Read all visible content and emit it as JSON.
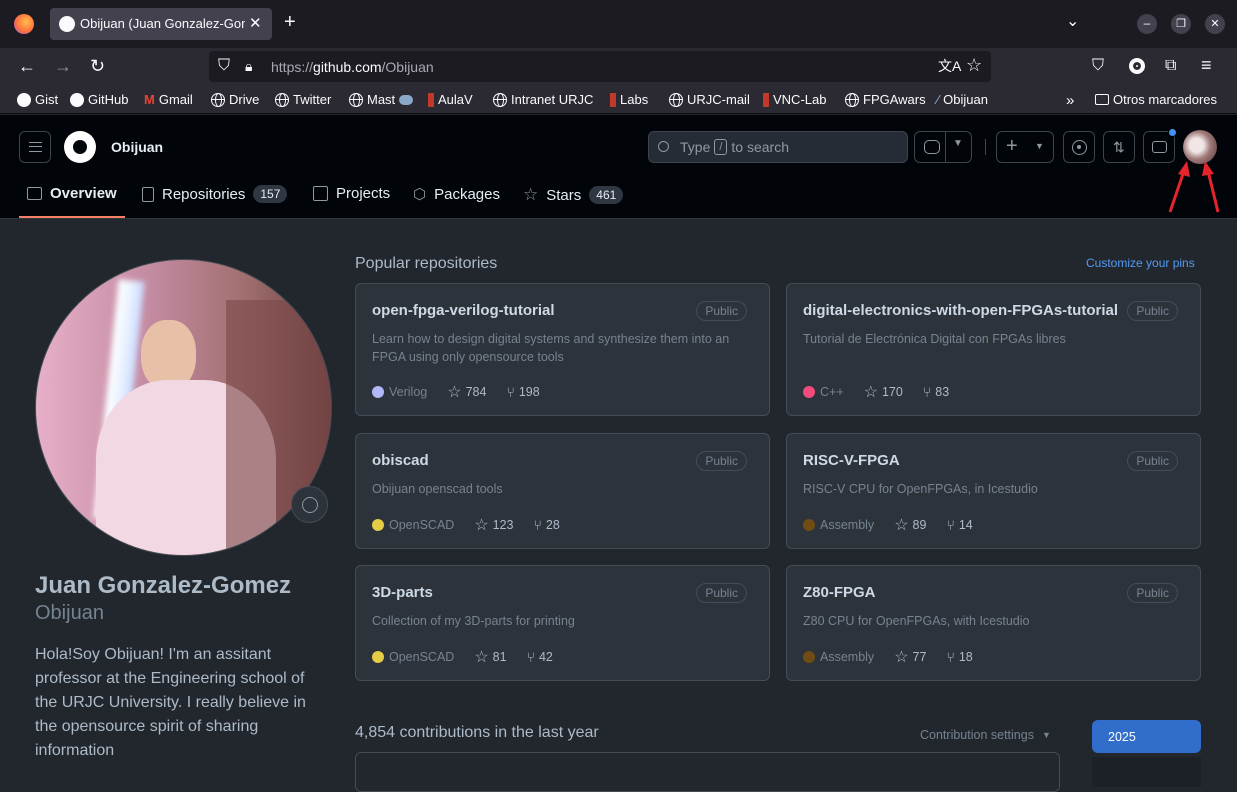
{
  "browser": {
    "tab_title": "Obijuan (Juan Gonzalez-Gomez)",
    "url_prefix": "https://",
    "url_host": "github.com",
    "url_path": "/Obijuan",
    "bookmarks": [
      "Gist",
      "GitHub",
      "Gmail",
      "Drive",
      "Twitter",
      "Mast",
      "AulaV",
      "Intranet URJC",
      "Labs",
      "URJC-mail",
      "VNC-Lab",
      "FPGAwars",
      "Obijuan"
    ],
    "other_bookmarks": "Otros marcadores"
  },
  "header": {
    "username": "Obijuan",
    "search_prefix": "Type",
    "search_key": "/",
    "search_suffix": "to search",
    "tabs": [
      {
        "label": "Overview",
        "count": ""
      },
      {
        "label": "Repositories",
        "count": "157"
      },
      {
        "label": "Projects",
        "count": ""
      },
      {
        "label": "Packages",
        "count": ""
      },
      {
        "label": "Stars",
        "count": "461"
      }
    ]
  },
  "profile": {
    "name": "Juan Gonzalez-Gomez",
    "login": "Obijuan",
    "bio": "Hola!Soy Obijuan! I'm an assitant professor at the Engineering school of the URJC University. I really believe in the opensource spirit of sharing information"
  },
  "popular": {
    "heading": "Popular repositories",
    "customize": "Customize your pins",
    "repos": [
      {
        "name": "open-fpga-verilog-tutorial",
        "visibility": "Public",
        "desc": "Learn how to design digital systems and synthesize them into an FPGA using only opensource tools",
        "lang": "Verilog",
        "lang_color": "#b2b7f8",
        "stars": "784",
        "forks": "198"
      },
      {
        "name": "digital-electronics-with-open-FPGAs-tutorial",
        "visibility": "Public",
        "desc": "Tutorial de Electrónica Digital con FPGAs libres",
        "lang": "C++",
        "lang_color": "#f34b7d",
        "stars": "170",
        "forks": "83"
      },
      {
        "name": "obiscad",
        "visibility": "Public",
        "desc": "Obijuan openscad tools",
        "lang": "OpenSCAD",
        "lang_color": "#e5cd45",
        "stars": "123",
        "forks": "28"
      },
      {
        "name": "RISC-V-FPGA",
        "visibility": "Public",
        "desc": "RISC-V CPU for OpenFPGAs, in Icestudio",
        "lang": "Assembly",
        "lang_color": "#6e4c13",
        "stars": "89",
        "forks": "14"
      },
      {
        "name": "3D-parts",
        "visibility": "Public",
        "desc": "Collection of my 3D-parts for printing",
        "lang": "OpenSCAD",
        "lang_color": "#e5cd45",
        "stars": "81",
        "forks": "42"
      },
      {
        "name": "Z80-FPGA",
        "visibility": "Public",
        "desc": "Z80 CPU for OpenFPGAs, with Icestudio",
        "lang": "Assembly",
        "lang_color": "#6e4c13",
        "stars": "77",
        "forks": "18"
      }
    ]
  },
  "contrib": {
    "heading": "4,854 contributions in the last year",
    "settings": "Contribution settings",
    "year": "2025"
  }
}
